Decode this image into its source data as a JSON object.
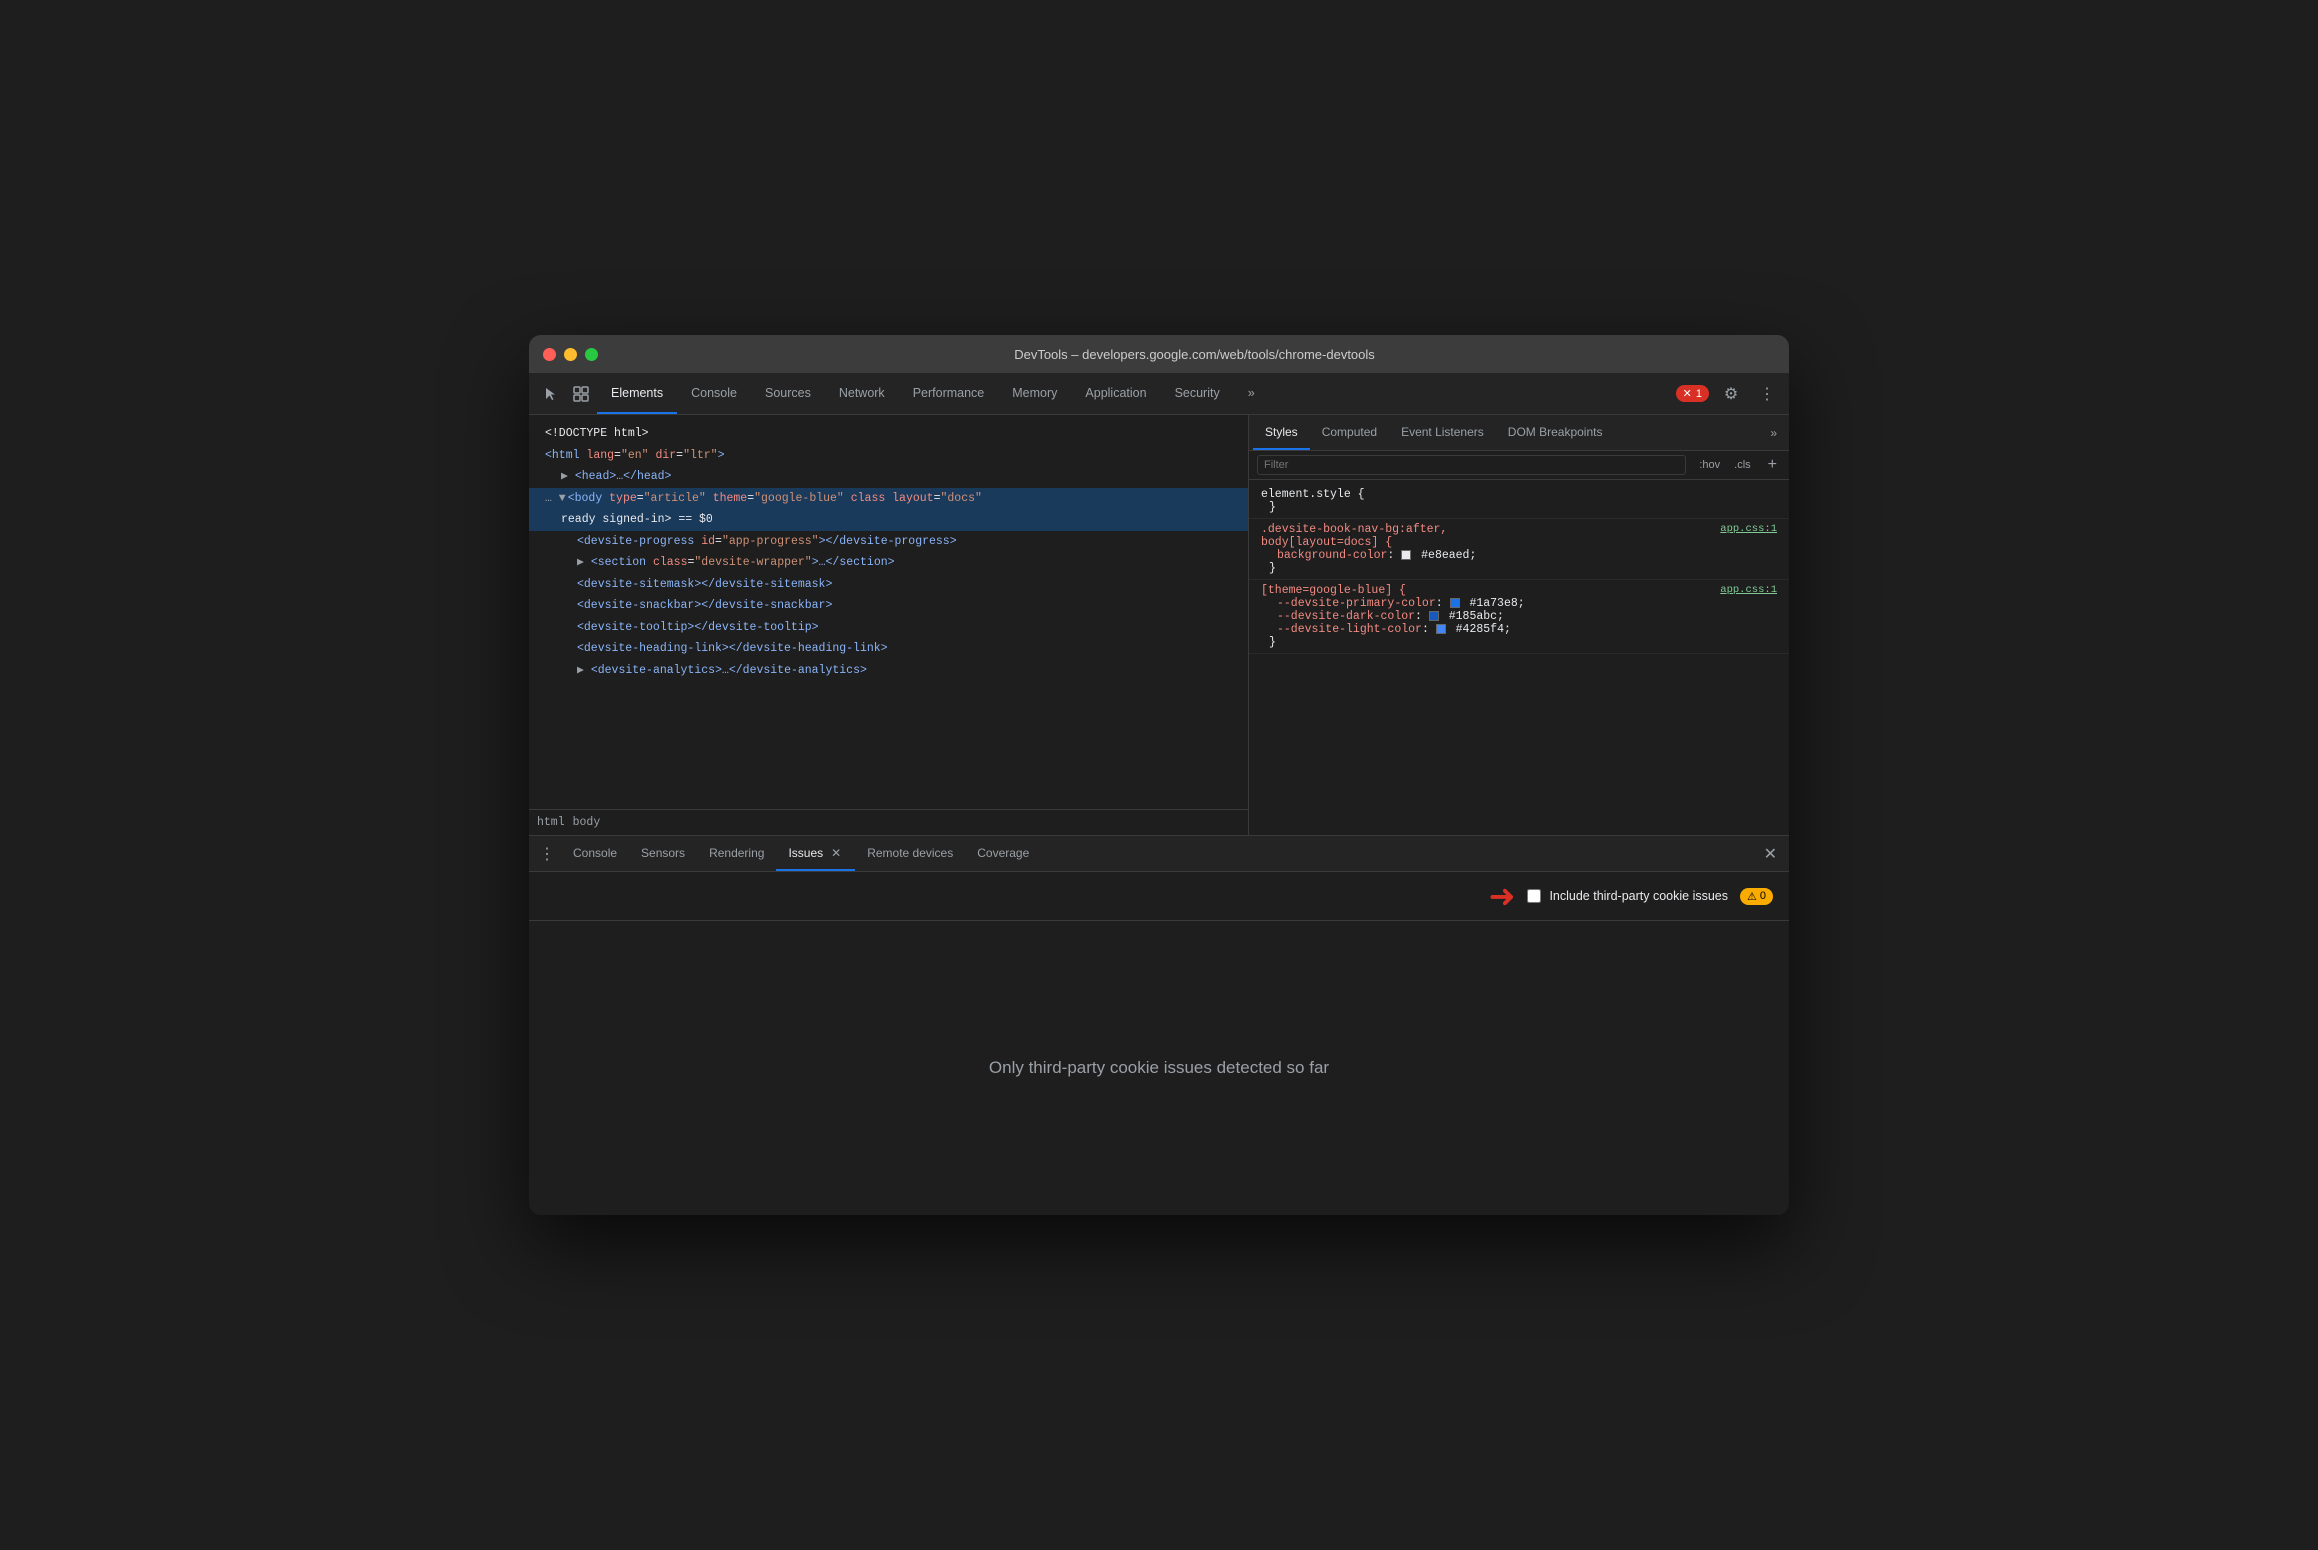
{
  "window": {
    "title": "DevTools – developers.google.com/web/tools/chrome-devtools"
  },
  "toolbar": {
    "tabs": [
      {
        "id": "elements",
        "label": "Elements",
        "active": true
      },
      {
        "id": "console",
        "label": "Console",
        "active": false
      },
      {
        "id": "sources",
        "label": "Sources",
        "active": false
      },
      {
        "id": "network",
        "label": "Network",
        "active": false
      },
      {
        "id": "performance",
        "label": "Performance",
        "active": false
      },
      {
        "id": "memory",
        "label": "Memory",
        "active": false
      },
      {
        "id": "application",
        "label": "Application",
        "active": false
      },
      {
        "id": "security",
        "label": "Security",
        "active": false
      }
    ],
    "more_label": "»",
    "error_count": "1",
    "error_icon": "✕"
  },
  "dom": {
    "lines": [
      {
        "text": "<!DOCTYPE html>",
        "indent": 0,
        "selected": false
      },
      {
        "text": "",
        "indent": 0,
        "selected": false,
        "html": "<span class='tag'>&lt;html</span> <span class='attr-name'>lang</span><span class='css-colon'>=</span><span class='attr-value'>\"en\"</span> <span class='attr-name'>dir</span><span class='css-colon'>=</span><span class='attr-value'>\"ltr\"</span><span class='tag'>&gt;</span>"
      },
      {
        "indent": 1,
        "selected": false,
        "html": "▶ <span class='tag'>&lt;head&gt;…&lt;/head&gt;</span>"
      },
      {
        "indent": 0,
        "selected": true,
        "html": "<span class='dots'>… ▼</span><span class='tag'>&lt;body</span> <span class='attr-name'>type</span><span class='css-colon'>=</span><span class='attr-value'>\"article\"</span> <span class='attr-name'>theme</span><span class='css-colon'>=</span><span class='attr-value'>\"google-blue\"</span> <span class='attr-name'>class</span> <span class='attr-name'>layout</span><span class='css-colon'>=</span><span class='attr-value'>\"docs\"</span>"
      },
      {
        "indent": 1,
        "selected": true,
        "html": "<span style='color:#e8eaed'>ready signed-in&gt; == $0</span>"
      },
      {
        "indent": 2,
        "selected": false,
        "html": "<span class='tag'>&lt;devsite-progress</span> <span class='attr-name'>id</span><span class='css-colon'>=</span><span class='attr-value'>\"app-progress\"</span><span class='tag'>&gt;&lt;/devsite-progress&gt;</span>"
      },
      {
        "indent": 2,
        "selected": false,
        "html": "▶ <span class='tag'>&lt;section</span> <span class='attr-name'>class</span><span class='css-colon'>=</span><span class='attr-value'>\"devsite-wrapper\"</span><span class='tag'>&gt;…&lt;/section&gt;</span>"
      },
      {
        "indent": 2,
        "selected": false,
        "html": "<span class='tag'>&lt;devsite-sitemask&gt;&lt;/devsite-sitemask&gt;</span>"
      },
      {
        "indent": 2,
        "selected": false,
        "html": "<span class='tag'>&lt;devsite-snackbar&gt;&lt;/devsite-snackbar&gt;</span>"
      },
      {
        "indent": 2,
        "selected": false,
        "html": "<span class='tag'>&lt;devsite-tooltip&gt;&lt;/devsite-tooltip&gt;</span>"
      },
      {
        "indent": 2,
        "selected": false,
        "html": "<span class='tag'>&lt;devsite-heading-link&gt;&lt;/devsite-heading-link&gt;</span>"
      },
      {
        "indent": 2,
        "selected": false,
        "html": "▶ <span class='tag'>&lt;devsite-analytics&gt;…&lt;/devsite-analytics&gt;</span>"
      }
    ],
    "breadcrumb": [
      "html",
      "body"
    ]
  },
  "styles_panel": {
    "tabs": [
      {
        "id": "styles",
        "label": "Styles",
        "active": true
      },
      {
        "id": "computed",
        "label": "Computed",
        "active": false
      },
      {
        "id": "event-listeners",
        "label": "Event Listeners",
        "active": false
      },
      {
        "id": "dom-breakpoints",
        "label": "DOM Breakpoints",
        "active": false
      }
    ],
    "more_label": "»",
    "filter_placeholder": "Filter",
    "filter_hov": ":hov",
    "filter_cls": ".cls",
    "rules": [
      {
        "selector": "element.style {",
        "source": "",
        "properties": [],
        "close": "}"
      },
      {
        "selector": ".devsite-book-nav-bg:after,\nbody[layout=docs] {",
        "source": "app.css:1",
        "properties": [
          {
            "prop": "background-color:",
            "val": "#e8eaed",
            "color": "#e8eaed"
          }
        ],
        "close": "}"
      },
      {
        "selector": "[theme=google-blue] {",
        "source": "app.css:1",
        "properties": [
          {
            "prop": "--devsite-primary-color:",
            "val": "#1a73e8",
            "color": "#1a73e8"
          },
          {
            "prop": "--devsite-dark-color:",
            "val": "#185abc",
            "color": "#185abc"
          },
          {
            "prop": "--devsite-light-color:",
            "val": "#4285f4",
            "color": "#4285f4"
          }
        ],
        "close": "}"
      }
    ]
  },
  "drawer": {
    "tabs": [
      {
        "id": "console",
        "label": "Console",
        "active": false,
        "closeable": false
      },
      {
        "id": "sensors",
        "label": "Sensors",
        "active": false,
        "closeable": false
      },
      {
        "id": "rendering",
        "label": "Rendering",
        "active": false,
        "closeable": false
      },
      {
        "id": "issues",
        "label": "Issues",
        "active": true,
        "closeable": true
      },
      {
        "id": "remote-devices",
        "label": "Remote devices",
        "active": false,
        "closeable": false
      },
      {
        "id": "coverage",
        "label": "Coverage",
        "active": false,
        "closeable": false
      }
    ],
    "issues": {
      "include_label": "Include third-party cookie issues",
      "warning_count": "0",
      "empty_message": "Only third-party cookie issues detected so far"
    }
  }
}
